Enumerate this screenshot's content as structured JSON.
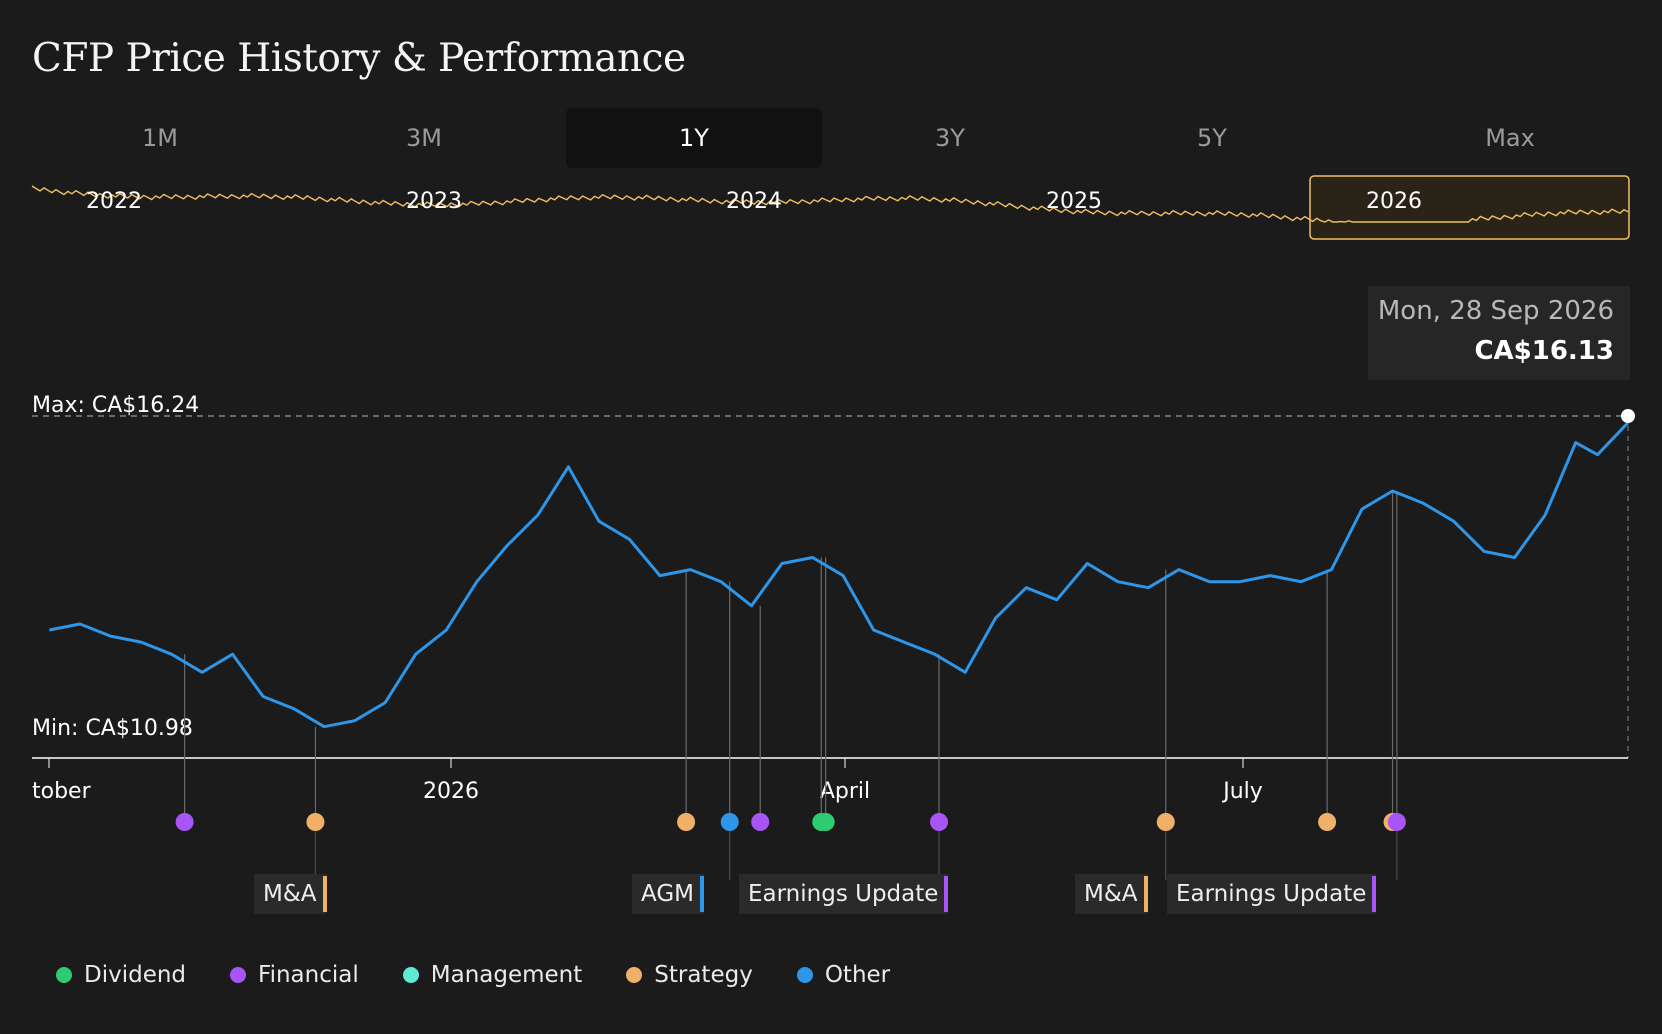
{
  "title": "CFP Price History & Performance",
  "tabs": [
    "1M",
    "3M",
    "1Y",
    "3Y",
    "5Y",
    "Max"
  ],
  "active_tab": "1Y",
  "navigator": {
    "year_labels": [
      "2022",
      "2023",
      "2024",
      "2025",
      "2026"
    ],
    "selected": "2026"
  },
  "tooltip": {
    "date": "Mon, 28 Sep 2026",
    "price": "CA$16.13"
  },
  "max_label": "Max: CA$16.24",
  "min_label": "Min: CA$10.98",
  "x_axis_labels": [
    "tober",
    "2026",
    "April",
    "July"
  ],
  "event_tags": [
    {
      "label": "M&A",
      "category": "Strategy"
    },
    {
      "label": "AGM",
      "category": "Other"
    },
    {
      "label": "Earnings Update",
      "category": "Financial"
    },
    {
      "label": "M&A",
      "category": "Strategy"
    },
    {
      "label": "Earnings Update",
      "category": "Financial"
    }
  ],
  "legend": [
    {
      "label": "Dividend",
      "color": "#2ecc71"
    },
    {
      "label": "Financial",
      "color": "#a855f7"
    },
    {
      "label": "Management",
      "color": "#5eead4"
    },
    {
      "label": "Strategy",
      "color": "#f0b068"
    },
    {
      "label": "Other",
      "color": "#2e96e8"
    }
  ],
  "colors": {
    "price_line": "#2e96e8",
    "navigator_line": "#f0c060",
    "background": "#1b1b1b"
  },
  "chart_data": {
    "type": "line",
    "title": "CFP Price History & Performance",
    "xlabel": "",
    "ylabel": "",
    "ylim": [
      10.98,
      16.24
    ],
    "grid": false,
    "series": [
      {
        "name": "",
        "x": [
          "2025-10-01",
          "2025-10-08",
          "2025-10-15",
          "2025-10-22",
          "2025-10-29",
          "2025-11-05",
          "2025-11-12",
          "2025-11-19",
          "2025-11-26",
          "2025-12-03",
          "2025-12-10",
          "2025-12-17",
          "2025-12-24",
          "2025-12-31",
          "2026-01-07",
          "2026-01-14",
          "2026-01-21",
          "2026-01-28",
          "2026-02-04",
          "2026-02-11",
          "2026-02-18",
          "2026-02-25",
          "2026-03-04",
          "2026-03-11",
          "2026-03-18",
          "2026-03-25",
          "2026-04-01",
          "2026-04-08",
          "2026-04-15",
          "2026-04-22",
          "2026-04-29",
          "2026-05-06",
          "2026-05-13",
          "2026-05-20",
          "2026-05-27",
          "2026-06-03",
          "2026-06-10",
          "2026-06-17",
          "2026-06-24",
          "2026-07-01",
          "2026-07-08",
          "2026-07-15",
          "2026-07-22",
          "2026-07-29",
          "2026-08-05",
          "2026-08-12",
          "2026-08-19",
          "2026-08-26",
          "2026-09-02",
          "2026-09-09",
          "2026-09-16",
          "2026-09-21",
          "2026-09-28"
        ],
        "values": [
          12.7,
          12.8,
          12.6,
          12.5,
          12.3,
          12.0,
          12.3,
          11.6,
          11.4,
          11.1,
          11.2,
          11.5,
          12.3,
          12.7,
          13.5,
          14.1,
          14.6,
          15.4,
          14.5,
          14.2,
          13.6,
          13.7,
          13.5,
          13.1,
          13.8,
          13.9,
          13.6,
          12.7,
          12.5,
          12.3,
          12.0,
          12.9,
          13.4,
          13.2,
          13.8,
          13.5,
          13.4,
          13.7,
          13.5,
          13.5,
          13.6,
          13.5,
          13.7,
          14.7,
          15.0,
          14.8,
          14.5,
          14.0,
          13.9,
          14.6,
          15.8,
          15.6,
          16.13
        ]
      }
    ],
    "events": [
      {
        "date": "2025-11-01",
        "category": "Financial"
      },
      {
        "date": "2025-12-01",
        "category": "Strategy",
        "tag": "M&A"
      },
      {
        "date": "2026-02-24",
        "category": "Strategy"
      },
      {
        "date": "2026-03-06",
        "category": "Other",
        "tag": "AGM"
      },
      {
        "date": "2026-03-13",
        "category": "Financial"
      },
      {
        "date": "2026-03-27",
        "category": "Dividend"
      },
      {
        "date": "2026-03-28",
        "category": "Dividend"
      },
      {
        "date": "2026-04-23",
        "category": "Financial",
        "tag": "Earnings Update"
      },
      {
        "date": "2026-06-14",
        "category": "Strategy",
        "tag": "M&A"
      },
      {
        "date": "2026-07-21",
        "category": "Strategy"
      },
      {
        "date": "2026-08-05",
        "category": "Strategy"
      },
      {
        "date": "2026-08-06",
        "category": "Financial",
        "tag": "Earnings Update"
      }
    ]
  }
}
